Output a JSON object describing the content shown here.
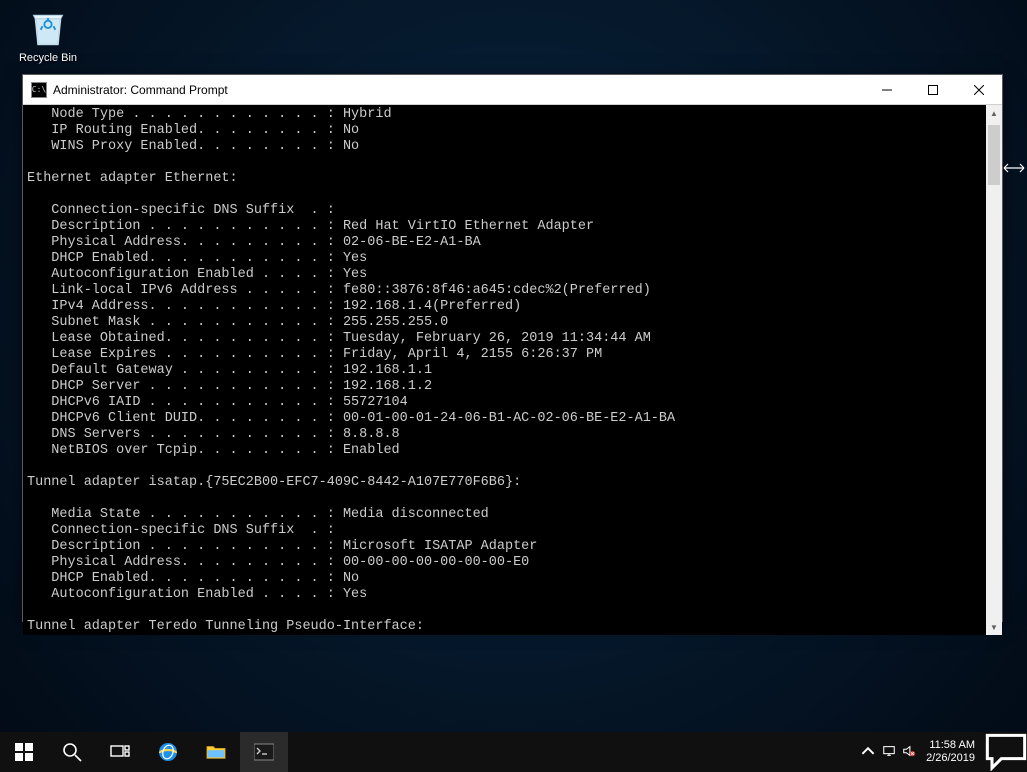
{
  "desktop": {
    "recycle_label": "Recycle Bin"
  },
  "window": {
    "title": "Administrator: Command Prompt",
    "body_lines": [
      "   Node Type . . . . . . . . . . . . : Hybrid",
      "   IP Routing Enabled. . . . . . . . : No",
      "   WINS Proxy Enabled. . . . . . . . : No",
      "",
      "Ethernet adapter Ethernet:",
      "",
      "   Connection-specific DNS Suffix  . :",
      "   Description . . . . . . . . . . . : Red Hat VirtIO Ethernet Adapter",
      "   Physical Address. . . . . . . . . : 02-06-BE-E2-A1-BA",
      "   DHCP Enabled. . . . . . . . . . . : Yes",
      "   Autoconfiguration Enabled . . . . : Yes",
      "   Link-local IPv6 Address . . . . . : fe80::3876:8f46:a645:cdec%2(Preferred)",
      "   IPv4 Address. . . . . . . . . . . : 192.168.1.4(Preferred)",
      "   Subnet Mask . . . . . . . . . . . : 255.255.255.0",
      "   Lease Obtained. . . . . . . . . . : Tuesday, February 26, 2019 11:34:44 AM",
      "   Lease Expires . . . . . . . . . . : Friday, April 4, 2155 6:26:37 PM",
      "   Default Gateway . . . . . . . . . : 192.168.1.1",
      "   DHCP Server . . . . . . . . . . . : 192.168.1.2",
      "   DHCPv6 IAID . . . . . . . . . . . : 55727104",
      "   DHCPv6 Client DUID. . . . . . . . : 00-01-00-01-24-06-B1-AC-02-06-BE-E2-A1-BA",
      "   DNS Servers . . . . . . . . . . . : 8.8.8.8",
      "   NetBIOS over Tcpip. . . . . . . . : Enabled",
      "",
      "Tunnel adapter isatap.{75EC2B00-EFC7-409C-8442-A107E770F6B6}:",
      "",
      "   Media State . . . . . . . . . . . : Media disconnected",
      "   Connection-specific DNS Suffix  . :",
      "   Description . . . . . . . . . . . : Microsoft ISATAP Adapter",
      "   Physical Address. . . . . . . . . : 00-00-00-00-00-00-00-E0",
      "   DHCP Enabled. . . . . . . . . . . : No",
      "   Autoconfiguration Enabled . . . . : Yes",
      "",
      "Tunnel adapter Teredo Tunneling Pseudo-Interface:"
    ]
  },
  "taskbar": {
    "time": "11:58 AM",
    "date": "2/26/2019"
  }
}
